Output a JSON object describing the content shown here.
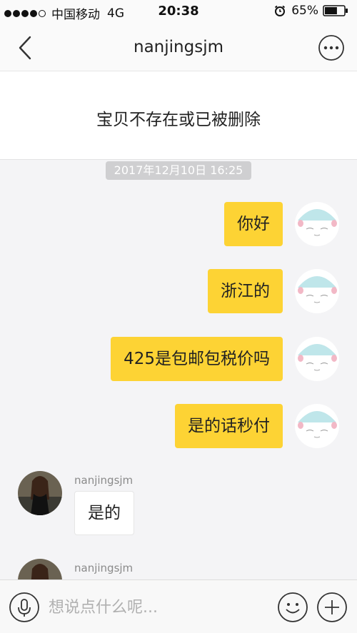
{
  "status_bar": {
    "signal_dots_filled": 4,
    "carrier": "中国移动",
    "network": "4G",
    "time": "20:38",
    "battery_percent_label": "65%",
    "battery_level": 0.65,
    "icons": [
      "alarm-icon",
      "battery-icon"
    ]
  },
  "nav": {
    "title": "nanjingsjm",
    "back_icon": "chevron-left-icon",
    "more_icon": "more-dots-icon"
  },
  "product_card": {
    "message": "宝贝不存在或已被删除"
  },
  "chat": {
    "timestamp": "2017年12月10日 16:25",
    "outgoing": [
      {
        "text": "你好"
      },
      {
        "text": "浙江的"
      },
      {
        "text": "425是包邮包税价吗"
      },
      {
        "text": "是的话秒付"
      }
    ],
    "incoming": [
      {
        "sender": "nanjingsjm",
        "text": "是的"
      },
      {
        "sender": "nanjingsjm",
        "text": ""
      }
    ]
  },
  "input_bar": {
    "placeholder": "想说点什么呢...",
    "value": "",
    "icons": [
      "microphone-icon",
      "smiley-icon",
      "plus-icon"
    ]
  },
  "colors": {
    "outgoing_bubble": "#fdd334",
    "incoming_bubble": "#ffffff",
    "background": "#f4f4f6",
    "timestamp_pill": "#cfcfd1"
  }
}
